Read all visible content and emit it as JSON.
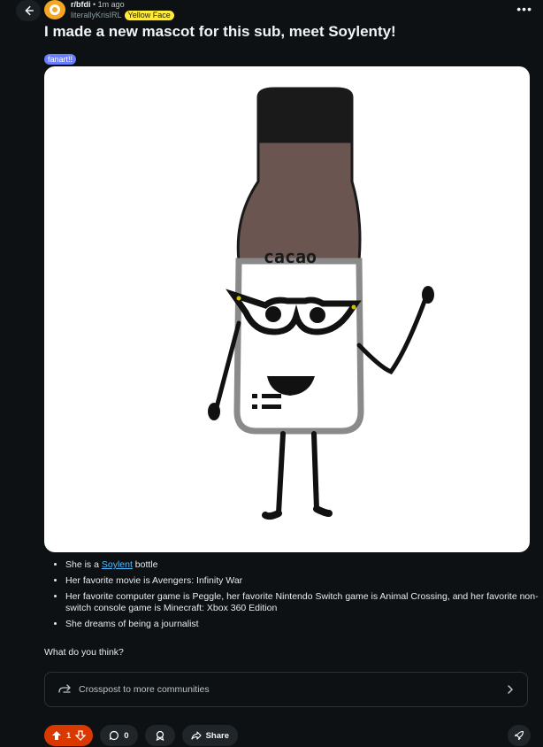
{
  "post": {
    "subreddit": "r/bfdi",
    "time": "1m ago",
    "author": "literallyKrisIRL",
    "author_flair": "Yellow Face",
    "title": "I made a new mascot for this sub, meet Soylenty!",
    "flair": "fanart!!",
    "image_text": "cacao",
    "body": {
      "items": [
        {
          "before": "She is a ",
          "link": "Soylent",
          "after": " bottle"
        },
        {
          "text": "Her favorite movie is Avengers: Infinity War"
        },
        {
          "text": "Her favorite computer game is Peggle, her favorite Nintendo Switch game is Animal Crossing, and her favorite non-switch console game is Minecraft: Xbox 360 Edition"
        },
        {
          "text": "She dreams of being a journalist"
        }
      ],
      "question": "What do you think?"
    },
    "crosspost_label": "Crosspost to more communities",
    "actions": {
      "vote_count": "1",
      "comment_count": "0",
      "share_label": "Share"
    }
  },
  "colors": {
    "background": "#0e1113",
    "upvote_active": "#d93900",
    "flair": "#6b7dff",
    "user_flair": "#ffeb3b",
    "link": "#4fbcff"
  },
  "icons": [
    "back-arrow-icon",
    "more-icon",
    "crosspost-icon",
    "chevron-right-icon",
    "upvote-icon",
    "downvote-icon",
    "comment-icon",
    "award-icon",
    "share-icon",
    "rocket-icon"
  ]
}
